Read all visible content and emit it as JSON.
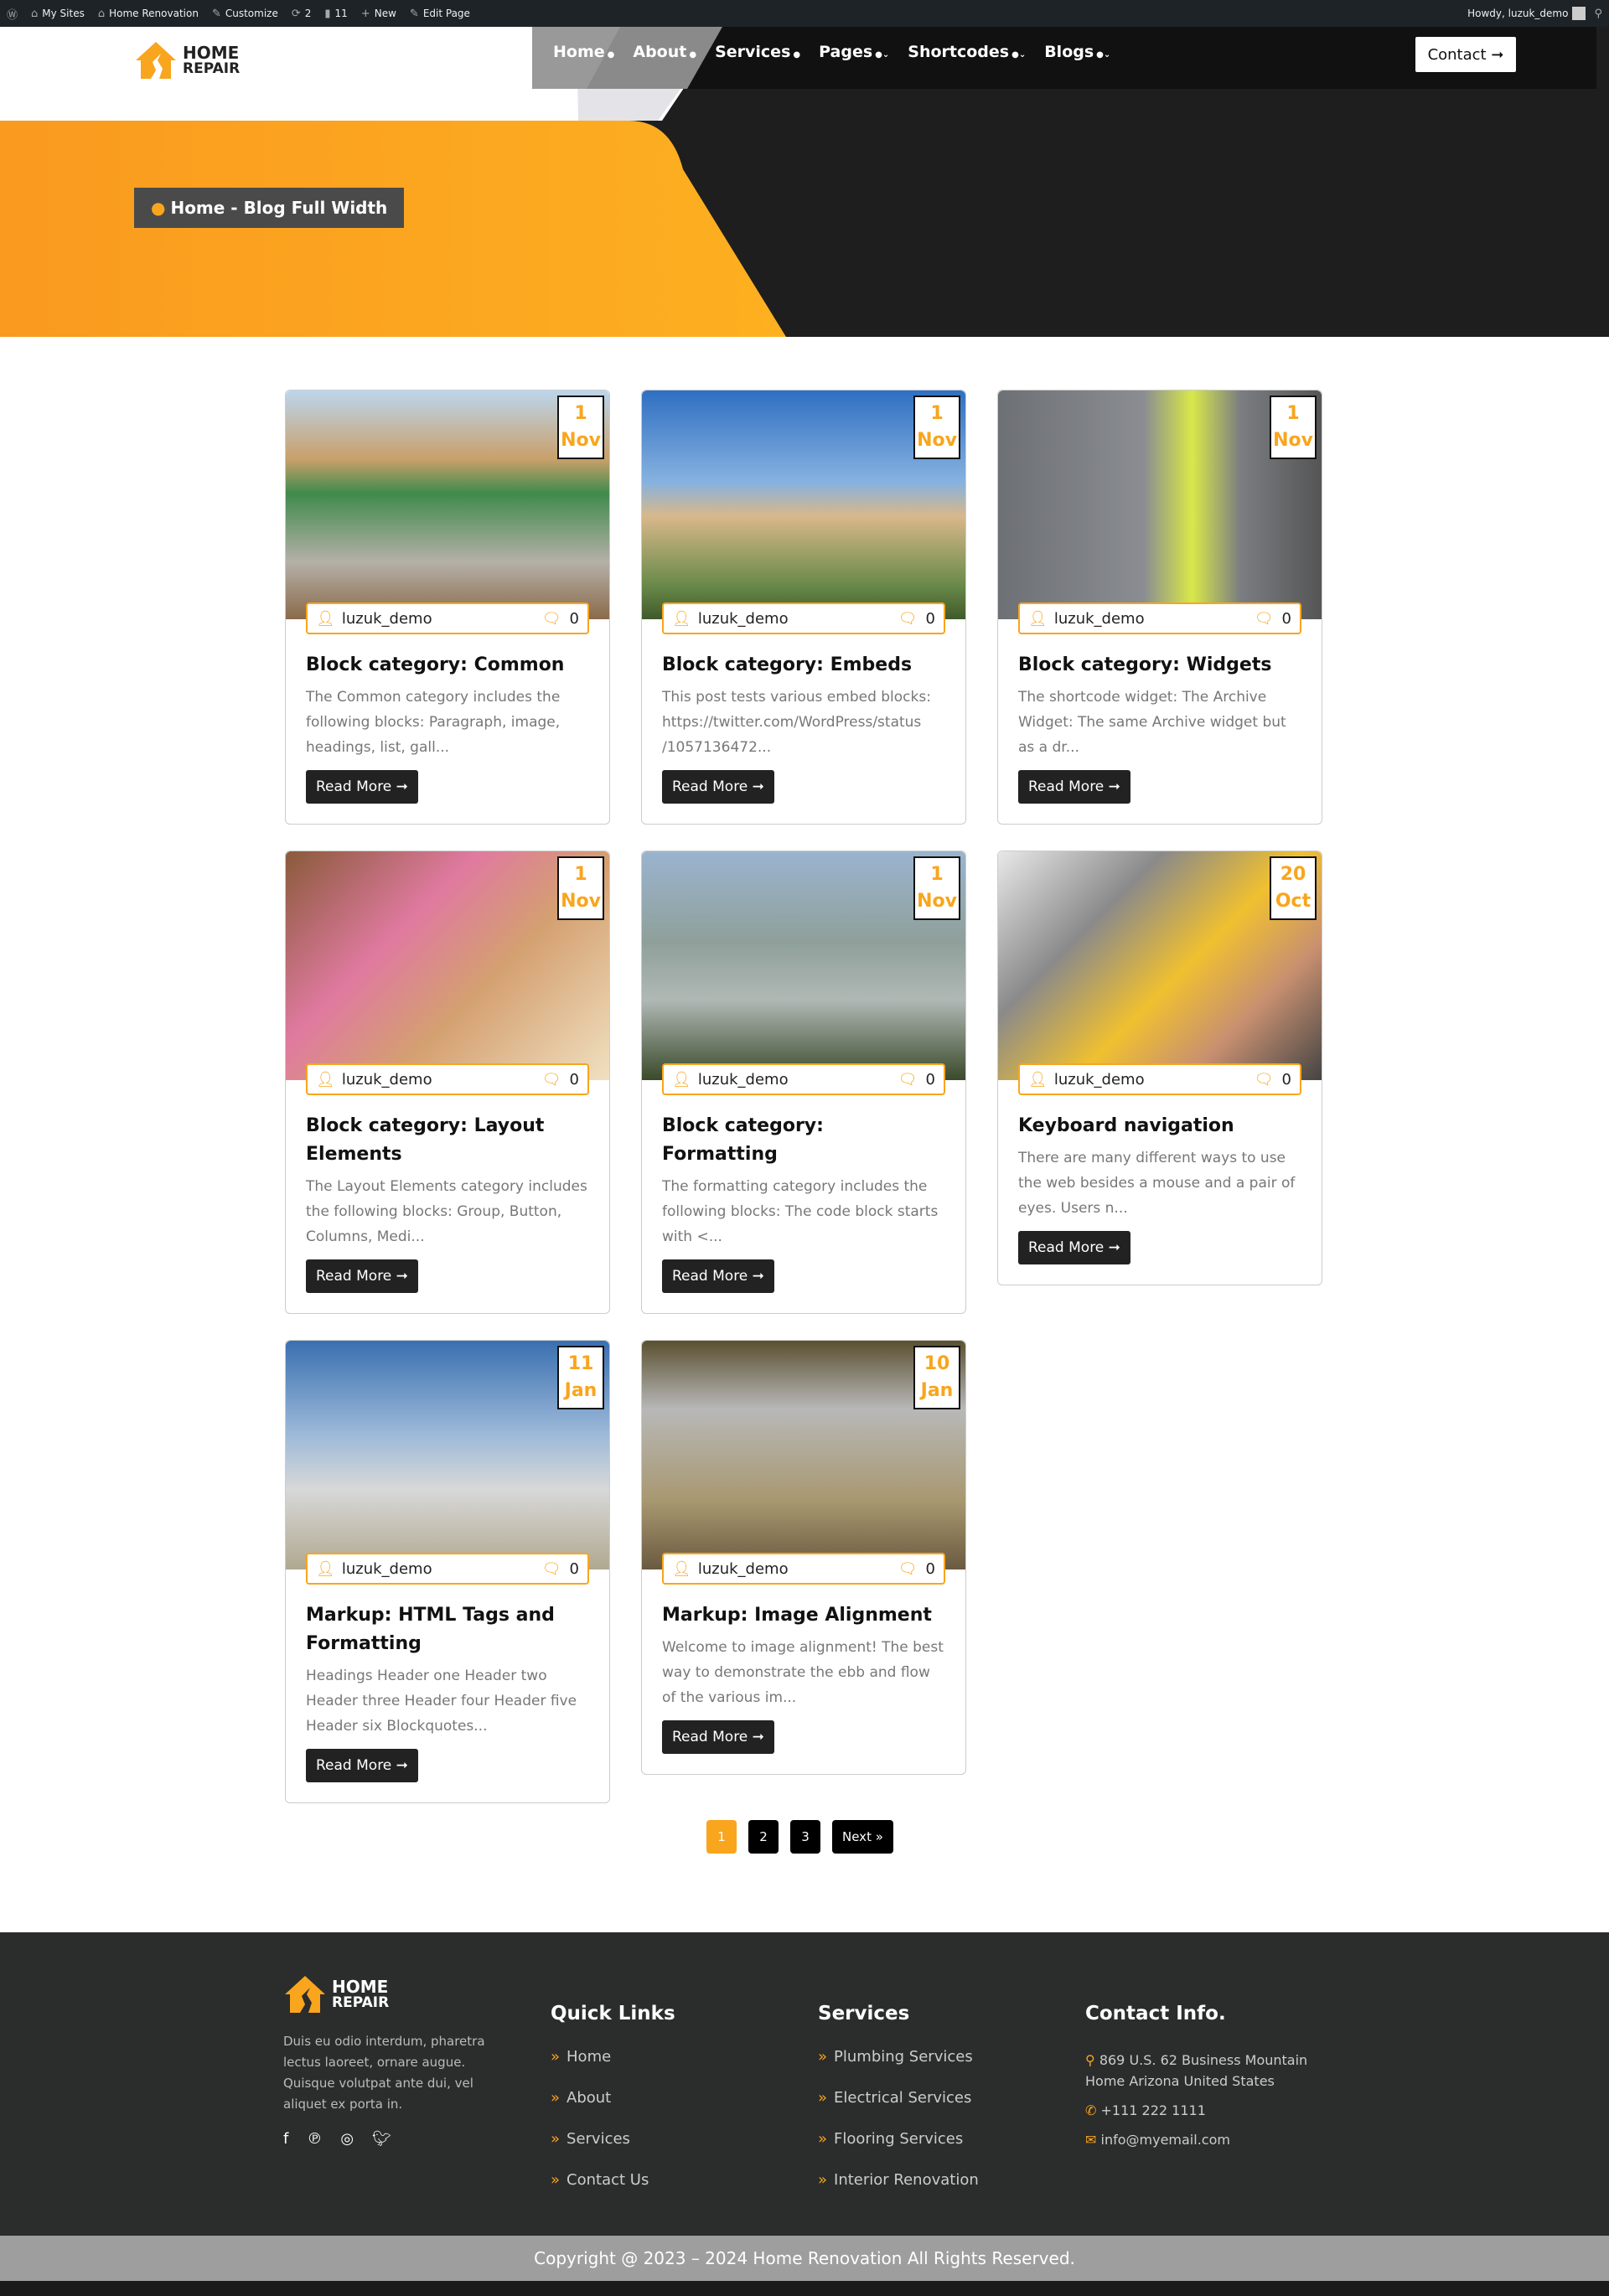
{
  "adminbar": {
    "items": [
      {
        "icon": "wordpress-icon",
        "label": ""
      },
      {
        "icon": "sites-icon",
        "label": "My Sites"
      },
      {
        "icon": "home-icon",
        "label": "Home Renovation"
      },
      {
        "icon": "brush-icon",
        "label": "Customize"
      },
      {
        "icon": "update-icon",
        "label": "2"
      },
      {
        "icon": "comment-icon",
        "label": "11"
      },
      {
        "icon": "plus-icon",
        "label": "New"
      },
      {
        "icon": "edit-icon",
        "label": "Edit Page"
      }
    ],
    "howdy": "Howdy, luzuk_demo"
  },
  "logo": {
    "line1": "HOME",
    "line2": "REPAIR"
  },
  "nav": {
    "items": [
      "Home",
      "About",
      "Services",
      "Pages",
      "Shortcodes",
      "Blogs"
    ],
    "contact": "Contact"
  },
  "breadcrumb": "Home - Blog Full Width",
  "colors": {
    "accent": "#f9a51d",
    "dark": "#1e1e1e"
  },
  "posts": [
    {
      "day": "1",
      "month": "Nov",
      "author": "luzuk_demo",
      "comments": "0",
      "title": "Block category: Common",
      "excerpt": "The Common category includes the following blocks: Paragraph, image, headings, list, gall...",
      "read_more": "Read More"
    },
    {
      "day": "1",
      "month": "Nov",
      "author": "luzuk_demo",
      "comments": "0",
      "title": "Block category: Embeds",
      "excerpt": "This post tests various embed blocks: https://twitter.com/WordPress/status /1057136472...",
      "read_more": "Read More"
    },
    {
      "day": "1",
      "month": "Nov",
      "author": "luzuk_demo",
      "comments": "0",
      "title": "Block category: Widgets",
      "excerpt": "The shortcode widget: The Archive Widget: The same Archive widget but as a dr...",
      "read_more": "Read More"
    },
    {
      "day": "1",
      "month": "Nov",
      "author": "luzuk_demo",
      "comments": "0",
      "title": "Block category: Layout Elements",
      "excerpt": "The Layout Elements category includes the following blocks: Group, Button, Columns, Medi...",
      "read_more": "Read More"
    },
    {
      "day": "1",
      "month": "Nov",
      "author": "luzuk_demo",
      "comments": "0",
      "title": "Block category: Formatting",
      "excerpt": "The formatting category includes the following blocks: The code block starts with <...",
      "read_more": "Read More"
    },
    {
      "day": "20",
      "month": "Oct",
      "author": "luzuk_demo",
      "comments": "0",
      "title": "Keyboard navigation",
      "excerpt": "There are many different ways to use the web besides a mouse and a pair of eyes. Users n...",
      "read_more": "Read More"
    },
    {
      "day": "11",
      "month": "Jan",
      "author": "luzuk_demo",
      "comments": "0",
      "title": "Markup: HTML Tags and Formatting",
      "excerpt": "Headings Header one Header two Header three Header four Header five Header six Blockquotes...",
      "read_more": "Read More"
    },
    {
      "day": "10",
      "month": "Jan",
      "author": "luzuk_demo",
      "comments": "0",
      "title": "Markup: Image Alignment",
      "excerpt": "Welcome to image alignment! The best way to demonstrate the ebb and flow of the various im...",
      "read_more": "Read More"
    }
  ],
  "pagination": {
    "pages": [
      "1",
      "2",
      "3"
    ],
    "current": "1",
    "next": "Next »"
  },
  "footer": {
    "about": "Duis eu odio interdum, pharetra lectus laoreet, ornare augue. Quisque volutpat ante dui, vel aliquet ex porta in.",
    "quick_links": {
      "title": "Quick Links",
      "items": [
        "Home",
        "About",
        "Services",
        "Contact Us"
      ]
    },
    "services": {
      "title": "Services",
      "items": [
        "Plumbing Services",
        "Electrical Services",
        "Flooring Services",
        "Interior Renovation"
      ]
    },
    "contact": {
      "title": "Contact Info.",
      "address": "869 U.S. 62 Business Mountain Home Arizona United States",
      "phone": "+111 222 1111",
      "email": "info@myemail.com"
    },
    "social": [
      "facebook-icon",
      "pinterest-icon",
      "instagram-icon",
      "twitter-icon"
    ],
    "copyright": "Copyright @ 2023 – 2024 Home Renovation All Rights Reserved."
  }
}
